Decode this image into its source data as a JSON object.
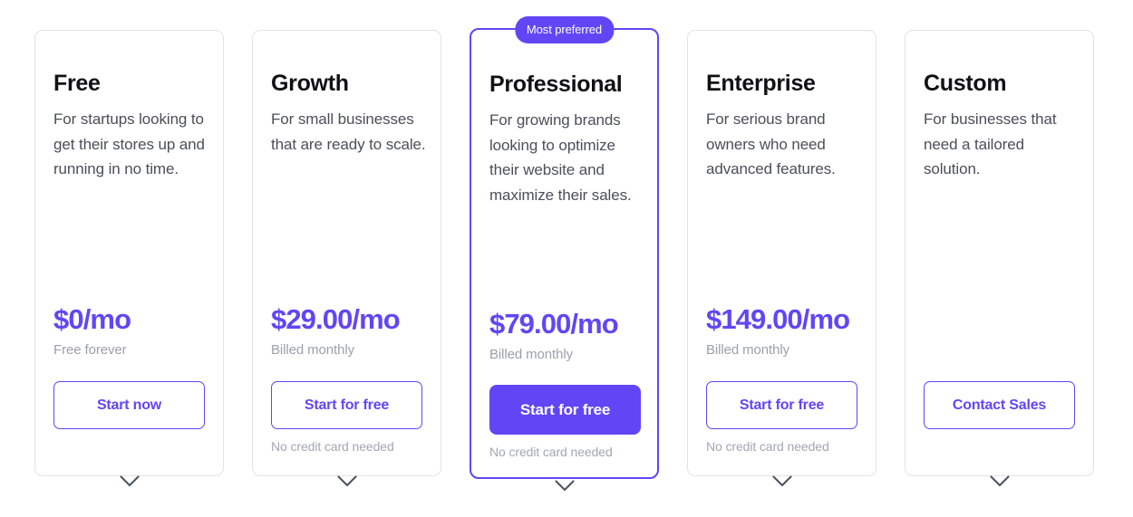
{
  "theme": {
    "accent": "#6246f5",
    "card_border": "#e2e3e6",
    "title_color": "#111114",
    "desc_color": "#4b4f58",
    "muted_color": "#9ba0ab",
    "note_color": "#a2a7b2",
    "chevron_color": "#4b5563",
    "page_background": "#ffffff"
  },
  "plans": [
    {
      "name": "Free",
      "description": "For startups looking to get their stores up and running in no time.",
      "price": "$0",
      "price_suffix": "/mo",
      "billing": "Free forever",
      "cta_label": "Start now",
      "cta_style": "outline",
      "note": "",
      "badge": "",
      "featured": false,
      "expand_icon": "chevron-down-icon"
    },
    {
      "name": "Growth",
      "description": "For small businesses that are ready to scale.",
      "price": "$29.00",
      "price_suffix": "/mo",
      "billing": "Billed monthly",
      "cta_label": "Start for free",
      "cta_style": "outline",
      "note": "No credit card needed",
      "badge": "",
      "featured": false,
      "expand_icon": "chevron-down-icon"
    },
    {
      "name": "Professional",
      "description": "For growing brands looking to optimize their website and maximize their sales.",
      "price": "$79.00",
      "price_suffix": "/mo",
      "billing": "Billed monthly",
      "cta_label": "Start for free",
      "cta_style": "filled",
      "note": "No credit card needed",
      "badge": "Most preferred",
      "featured": true,
      "expand_icon": "chevron-down-icon"
    },
    {
      "name": "Enterprise",
      "description": "For serious brand owners who need advanced features.",
      "price": "$149.00",
      "price_suffix": "/mo",
      "billing": "Billed monthly",
      "cta_label": "Start for free",
      "cta_style": "outline",
      "note": "No credit card needed",
      "badge": "",
      "featured": false,
      "expand_icon": "chevron-down-icon"
    },
    {
      "name": "Custom",
      "description": "For businesses that need a tailored solution.",
      "price": "",
      "price_suffix": "",
      "billing": "",
      "cta_label": "Contact Sales",
      "cta_style": "outline",
      "note": "",
      "badge": "",
      "featured": false,
      "expand_icon": "chevron-down-icon"
    }
  ]
}
